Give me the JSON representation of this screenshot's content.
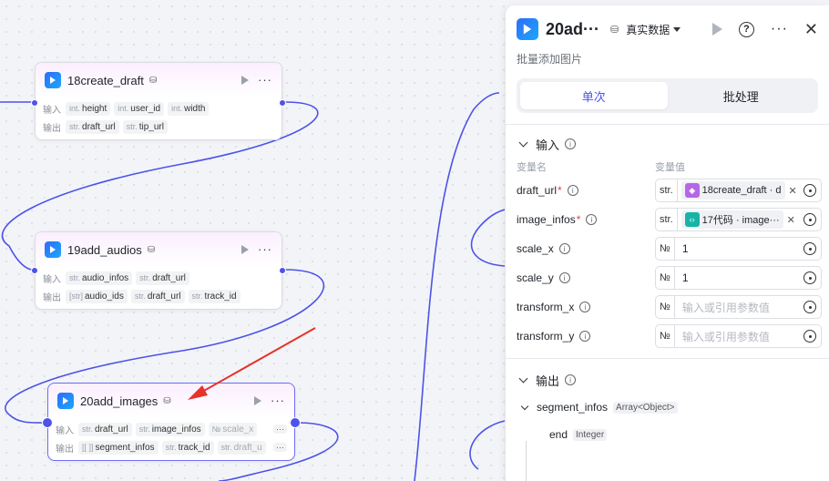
{
  "canvas": {
    "nodes": [
      {
        "id": "n18",
        "title": "18create_draft",
        "input_label": "输入",
        "output_label": "输出",
        "inputs": [
          {
            "type": "int.",
            "name": "height"
          },
          {
            "type": "int.",
            "name": "user_id"
          },
          {
            "type": "int.",
            "name": "width"
          }
        ],
        "outputs": [
          {
            "type": "str.",
            "name": "draft_url"
          },
          {
            "type": "str.",
            "name": "tip_url"
          }
        ]
      },
      {
        "id": "n19",
        "title": "19add_audios",
        "input_label": "输入",
        "output_label": "输出",
        "inputs": [
          {
            "type": "str.",
            "name": "audio_infos"
          },
          {
            "type": "str.",
            "name": "draft_url"
          }
        ],
        "outputs": [
          {
            "type": "[str]",
            "name": "audio_ids"
          },
          {
            "type": "str.",
            "name": "draft_url"
          },
          {
            "type": "str.",
            "name": "track_id"
          }
        ]
      },
      {
        "id": "n20",
        "title": "20add_images",
        "input_label": "输入",
        "output_label": "输出",
        "more": "···",
        "inputs": [
          {
            "type": "str.",
            "name": "draft_url"
          },
          {
            "type": "str.",
            "name": "image_infos"
          },
          {
            "type": "№",
            "name": "scale_x"
          }
        ],
        "outputs": [
          {
            "type": "[[ ]]",
            "name": "segment_infos"
          },
          {
            "type": "str.",
            "name": "track_id"
          },
          {
            "type": "str.",
            "name": "draft_u"
          }
        ]
      }
    ]
  },
  "panel": {
    "title": "20ad···",
    "mode": "真实数据",
    "description": "批量添加图片",
    "tabs": [
      "单次",
      "批处理"
    ],
    "active_tab": 0,
    "input_section": "输入",
    "col_name": "变量名",
    "col_value": "变量值",
    "params": [
      {
        "name": "draft_url",
        "required": true,
        "type": "str.",
        "ref": "18create_draft · d",
        "ref_color": "#b667e8",
        "value": "",
        "placeholder": ""
      },
      {
        "name": "image_infos",
        "required": true,
        "type": "str.",
        "ref": "17代码 · image···",
        "ref_color": "#17b3a6",
        "value": "",
        "placeholder": ""
      },
      {
        "name": "scale_x",
        "required": false,
        "type": "№",
        "ref": "",
        "value": "1",
        "placeholder": ""
      },
      {
        "name": "scale_y",
        "required": false,
        "type": "№",
        "ref": "",
        "value": "1",
        "placeholder": ""
      },
      {
        "name": "transform_x",
        "required": false,
        "type": "№",
        "ref": "",
        "value": "",
        "placeholder": "输入或引用参数值"
      },
      {
        "name": "transform_y",
        "required": false,
        "type": "№",
        "ref": "",
        "value": "",
        "placeholder": "输入或引用参数值"
      }
    ],
    "output_section": "输出",
    "outputs": [
      {
        "name": "segment_infos",
        "type": "Array<Object>"
      },
      {
        "name": "end",
        "type": "Integer"
      }
    ]
  },
  "colors": {
    "accent": "#4d53e8",
    "annotation_arrow": "#e5332a"
  }
}
